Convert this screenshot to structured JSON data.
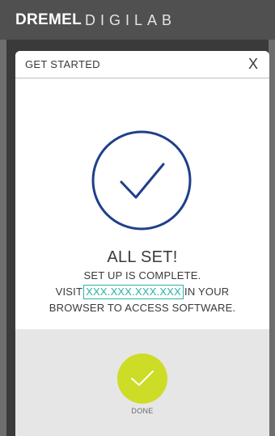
{
  "brand": {
    "name_strong": "DREMEL",
    "name_light": "DIGILAB"
  },
  "dialog": {
    "title": "GET STARTED",
    "close_label": "X"
  },
  "status": {
    "heading": "ALL SET!",
    "line1": "SET UP IS COMPLETE.",
    "line2_prefix": "VISIT",
    "ip_address": "XXX.XXX.XXX.XXX",
    "line2_suffix": "IN YOUR",
    "line3": "BROWSER TO ACCESS SOFTWARE."
  },
  "footer": {
    "done_label": "DONE"
  },
  "colors": {
    "accent_check": "#1f3f8a",
    "done_button": "#cddc26",
    "link": "#2bb3a3"
  },
  "icons": {
    "success": "check-circle-icon",
    "done": "check-icon"
  }
}
